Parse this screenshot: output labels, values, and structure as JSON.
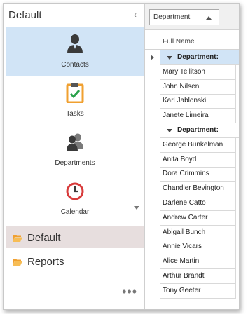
{
  "nav": {
    "title": "Default",
    "modules": [
      {
        "label": "Contacts",
        "icon": "contacts-icon",
        "selected": true
      },
      {
        "label": "Tasks",
        "icon": "tasks-icon",
        "selected": false
      },
      {
        "label": "Departments",
        "icon": "departments-icon",
        "selected": false
      },
      {
        "label": "Calendar",
        "icon": "calendar-icon",
        "selected": false
      }
    ],
    "groups": [
      {
        "label": "Default",
        "active": true
      },
      {
        "label": "Reports",
        "active": false
      }
    ],
    "more": "•••"
  },
  "grid": {
    "group_by": "Department",
    "column": "Full Name",
    "rows": [
      {
        "type": "group",
        "text": "Department:"
      },
      {
        "type": "data",
        "text": "Mary Tellitson"
      },
      {
        "type": "data",
        "text": "John Nilsen"
      },
      {
        "type": "data",
        "text": "Karl Jablonski"
      },
      {
        "type": "data",
        "text": "Janete Limeira"
      },
      {
        "type": "group",
        "text": "Department:"
      },
      {
        "type": "data",
        "text": "George Bunkelman"
      },
      {
        "type": "data",
        "text": "Anita Boyd"
      },
      {
        "type": "data",
        "text": "Dora Crimmins"
      },
      {
        "type": "data",
        "text": "Chandler Bevington"
      },
      {
        "type": "data",
        "text": "Darlene Catto"
      },
      {
        "type": "data",
        "text": "Andrew Carter"
      },
      {
        "type": "data",
        "text": "Abigail Bunch"
      },
      {
        "type": "data",
        "text": "Annie Vicars"
      },
      {
        "type": "data",
        "text": "Alice Martin"
      },
      {
        "type": "data",
        "text": "Arthur Brandt"
      },
      {
        "type": "data",
        "text": "Tony Geeter"
      }
    ]
  },
  "colors": {
    "selection": "#d1e4f6",
    "active_group": "#e7dede",
    "folder": "#f0a030",
    "tasks_accent": "#f0a030",
    "check": "#2ba24c",
    "calendar_red": "#d83b3b"
  }
}
